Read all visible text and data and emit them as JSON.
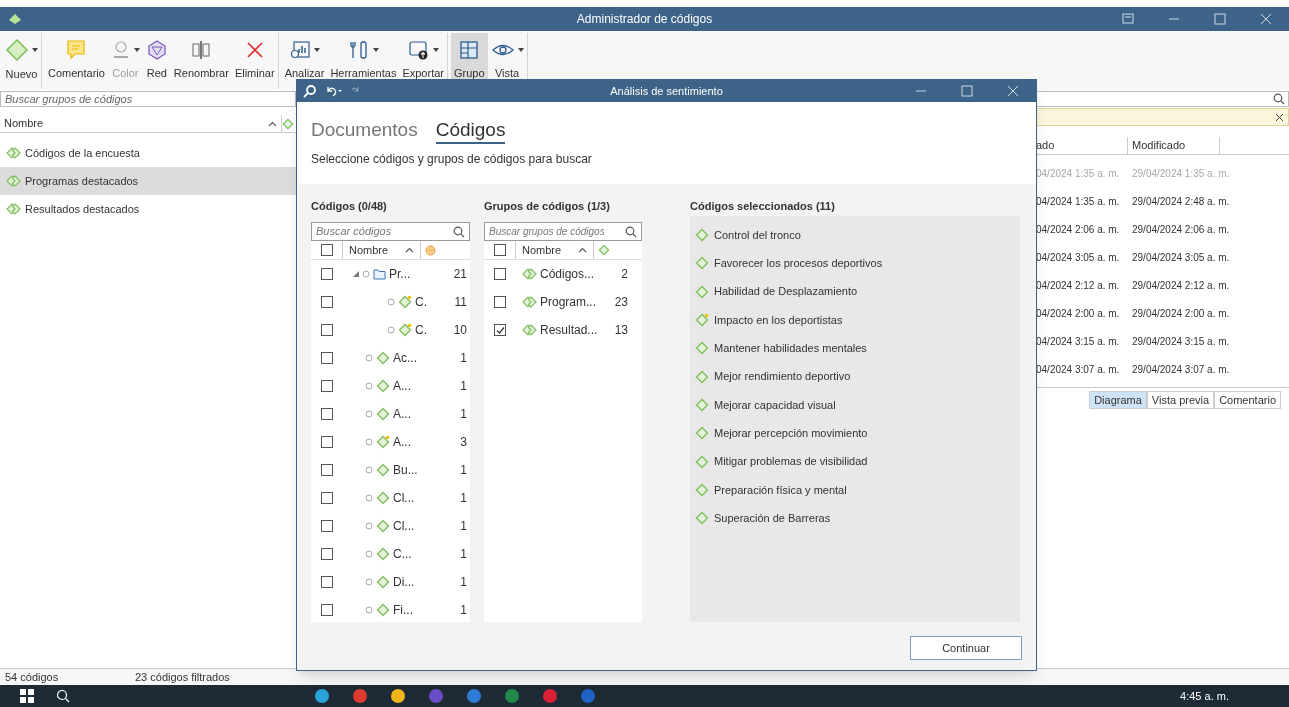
{
  "window": {
    "title": "Administrador de códigos"
  },
  "toolbar": [
    {
      "label": "Nuevo",
      "kind": "new",
      "dropdown": true,
      "disabled": false,
      "selected": false,
      "separator_after": true
    },
    {
      "label": "Comentario",
      "kind": "comment",
      "dropdown": false,
      "disabled": false,
      "selected": false,
      "separator_after": false
    },
    {
      "label": "Color",
      "kind": "color",
      "dropdown": true,
      "disabled": true,
      "selected": false,
      "separator_after": false
    },
    {
      "label": "Red",
      "kind": "network",
      "dropdown": false,
      "disabled": false,
      "selected": false,
      "separator_after": false
    },
    {
      "label": "Renombrar",
      "kind": "rename",
      "dropdown": false,
      "disabled": false,
      "selected": false,
      "separator_after": false
    },
    {
      "label": "Eliminar",
      "kind": "delete",
      "dropdown": false,
      "disabled": false,
      "selected": false,
      "separator_after": true
    },
    {
      "label": "Analizar",
      "kind": "analyze",
      "dropdown": true,
      "disabled": false,
      "selected": false,
      "separator_after": false
    },
    {
      "label": "Herramientas",
      "kind": "tools",
      "dropdown": true,
      "disabled": false,
      "selected": false,
      "separator_after": false
    },
    {
      "label": "Exportar",
      "kind": "export",
      "dropdown": true,
      "disabled": false,
      "selected": false,
      "separator_after": true
    },
    {
      "label": "Grupo",
      "kind": "group",
      "dropdown": false,
      "disabled": false,
      "selected": true,
      "separator_after": false
    },
    {
      "label": "Vista",
      "kind": "view",
      "dropdown": true,
      "disabled": false,
      "selected": false,
      "separator_after": true
    }
  ],
  "groups_pane": {
    "search": {
      "placeholder": "Buscar grupos de códigos"
    },
    "column": "Nombre",
    "items": [
      {
        "label": "Códigos de la encuesta",
        "selected": false
      },
      {
        "label": "Programas destacados",
        "selected": true
      },
      {
        "label": "Resultados destacados",
        "selected": false
      }
    ]
  },
  "details_pane": {
    "columns": [
      "ado",
      "Modificado"
    ],
    "rows": [
      {
        "cells": [
          "04/2024 1:35 a. m.",
          "29/04/2024 1:35 a. m."
        ],
        "dimmed": true
      },
      {
        "cells": [
          "04/2024 1:35 a. m.",
          "29/04/2024 2:48 a. m."
        ],
        "dimmed": false
      },
      {
        "cells": [
          "04/2024 2:06 a. m.",
          "29/04/2024 2:06 a. m."
        ],
        "dimmed": false
      },
      {
        "cells": [
          "04/2024 3:05 a. m.",
          "29/04/2024 3:05 a. m."
        ],
        "dimmed": false
      },
      {
        "cells": [
          "04/2024 2:12 a. m.",
          "29/04/2024 2:12 a. m."
        ],
        "dimmed": false
      },
      {
        "cells": [
          "04/2024 2:00 a. m.",
          "29/04/2024 2:00 a. m."
        ],
        "dimmed": false
      },
      {
        "cells": [
          "04/2024 3:15 a. m.",
          "29/04/2024 3:15 a. m."
        ],
        "dimmed": false
      },
      {
        "cells": [
          "04/2024 3:07 a. m.",
          "29/04/2024 3:07 a. m."
        ],
        "dimmed": false
      }
    ],
    "tabs": [
      {
        "label": "Diagrama",
        "selected": true
      },
      {
        "label": "Vista previa",
        "selected": false
      },
      {
        "label": "Comentario",
        "selected": false
      }
    ]
  },
  "status_bar": [
    "54 códigos",
    "23 códigos filtrados"
  ],
  "dialog": {
    "title": "Análisis de sentimiento",
    "tabs": [
      {
        "label": "Documentos",
        "selected": false
      },
      {
        "label": "Códigos",
        "selected": true
      }
    ],
    "instruction": "Seleccione códigos y grupos de códigos para buscar",
    "codes": {
      "title": "Códigos (0/48)",
      "search": {
        "placeholder": "Buscar códigos"
      },
      "column": "Nombre",
      "header_checked": false,
      "items": [
        {
          "label": "Pr...",
          "count": "21",
          "kind": "folder",
          "checked": false,
          "expanded": true,
          "children": [
            {
              "label": "C.",
              "count": "11",
              "kind": "code-star",
              "checked": false
            },
            {
              "label": "C.",
              "count": "10",
              "kind": "code-star",
              "checked": false
            }
          ]
        },
        {
          "label": "Ac...",
          "count": "1",
          "kind": "code",
          "checked": false
        },
        {
          "label": "A...",
          "count": "1",
          "kind": "code",
          "checked": false
        },
        {
          "label": "A...",
          "count": "1",
          "kind": "code",
          "checked": false
        },
        {
          "label": "A...",
          "count": "3",
          "kind": "code-star",
          "checked": false
        },
        {
          "label": "Bu...",
          "count": "1",
          "kind": "code",
          "checked": false
        },
        {
          "label": "Cl...",
          "count": "1",
          "kind": "code",
          "checked": false
        },
        {
          "label": "Cl...",
          "count": "1",
          "kind": "code",
          "checked": false
        },
        {
          "label": "C...",
          "count": "1",
          "kind": "code",
          "checked": false
        },
        {
          "label": "Di...",
          "count": "1",
          "kind": "code",
          "checked": false
        },
        {
          "label": "Fi...",
          "count": "1",
          "kind": "code",
          "checked": false
        }
      ]
    },
    "groups": {
      "title": "Grupos de códigos (1/3)",
      "search": {
        "placeholder": "Buscar grupos de códigos"
      },
      "column": "Nombre",
      "header_checked": false,
      "items": [
        {
          "label": "Códigos...",
          "count": "2",
          "checked": false
        },
        {
          "label": "Program...",
          "count": "23",
          "checked": false
        },
        {
          "label": "Resultad...",
          "count": "13",
          "checked": true
        }
      ]
    },
    "selected": {
      "title": "Códigos seleccionados (11)",
      "items": [
        {
          "label": "Control del tronco",
          "kind": "code"
        },
        {
          "label": "Favorecer los procesos deportivos",
          "kind": "code"
        },
        {
          "label": "Habilidad de Desplazamiento",
          "kind": "code"
        },
        {
          "label": "Impacto en los deportistas",
          "kind": "code-star"
        },
        {
          "label": "Mantener habilidades mentales",
          "kind": "code"
        },
        {
          "label": "Mejor rendimiento deportivo",
          "kind": "code"
        },
        {
          "label": "Mejorar capacidad visual",
          "kind": "code"
        },
        {
          "label": "Mejorar percepción movimiento",
          "kind": "code"
        },
        {
          "label": "Mitigar problemas de visibilidad",
          "kind": "code"
        },
        {
          "label": "Preparación física y mental",
          "kind": "code"
        },
        {
          "label": "Superación de Barreras",
          "kind": "code"
        }
      ]
    },
    "button": "Continuar"
  },
  "taskbar": {
    "clock": "4:45 a. m."
  }
}
